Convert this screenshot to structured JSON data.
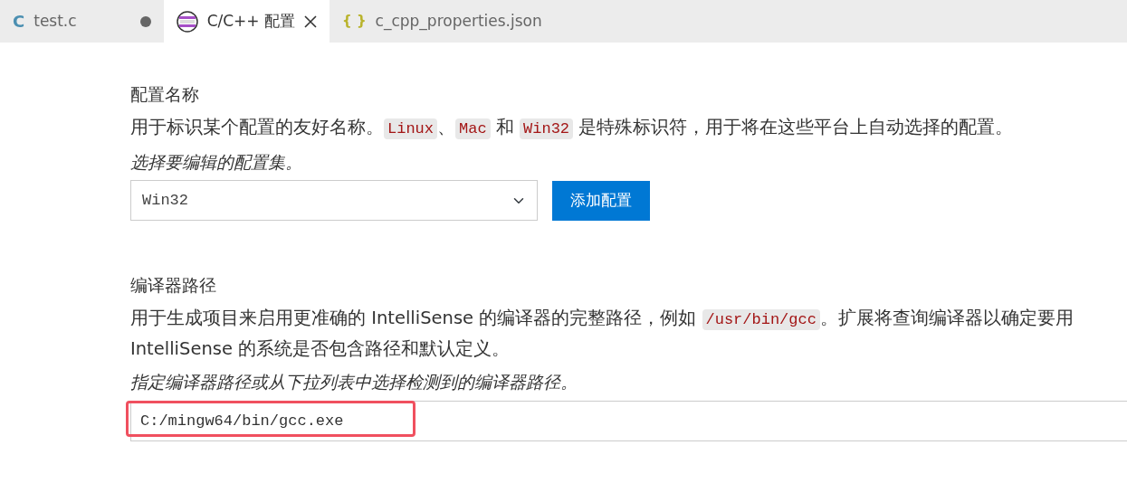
{
  "tabs": [
    {
      "kind": "c",
      "icon_text": "C",
      "label": "test.c",
      "selected": false,
      "modified": true
    },
    {
      "kind": "settings",
      "label": "C/C++ 配置",
      "selected": true,
      "modified": false
    },
    {
      "kind": "json",
      "icon_text": "{ }",
      "label": "c_cpp_properties.json",
      "selected": false,
      "modified": false
    }
  ],
  "sections": [
    {
      "title": "配置名称",
      "lines": [
        [
          {
            "kind": "text",
            "text": "用于标识某个配置的友好名称。"
          },
          {
            "kind": "code",
            "text": "Linux"
          },
          {
            "kind": "text",
            "text": "、"
          },
          {
            "kind": "code",
            "text": "Mac"
          },
          {
            "kind": "text",
            "text": " 和 "
          },
          {
            "kind": "code",
            "text": "Win32"
          },
          {
            "kind": "text",
            "text": " 是特殊标识符，用于将在这些平台上自动选择的配置。"
          }
        ]
      ],
      "hint": "选择要编辑的配置集。",
      "control": {
        "kind": "select",
        "value": "Win32",
        "button": "添加配置"
      }
    },
    {
      "title": "编译器路径",
      "lines": [
        [
          {
            "kind": "text",
            "text": "用于生成项目来启用更准确的 IntelliSense 的编译器的完整路径，例如 "
          },
          {
            "kind": "code",
            "text": "/usr/bin/gcc"
          },
          {
            "kind": "text",
            "text": "。扩展将查询编译器以确定要用"
          }
        ],
        [
          {
            "kind": "text",
            "text": "IntelliSense 的系统是否包含路径和默认定义。"
          }
        ]
      ],
      "hint": "指定编译器路径或从下拉列表中选择检测到的编译器路径。",
      "control": {
        "kind": "input",
        "value": "C:/mingw64/bin/gcc.exe",
        "highlighted": true
      }
    }
  ]
}
